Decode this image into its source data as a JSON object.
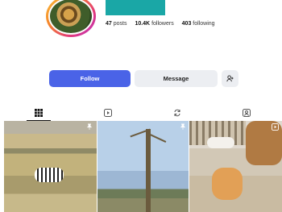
{
  "profile": {
    "posts_count": "47",
    "posts_label": "posts",
    "followers_count": "10.4K",
    "followers_label": "followers",
    "following_count": "403",
    "following_label": "following"
  },
  "actions": {
    "follow_label": "Follow",
    "message_label": "Message"
  },
  "tabs": [
    {
      "icon": "grid-icon",
      "active": true
    },
    {
      "icon": "reels-icon",
      "active": false
    },
    {
      "icon": "reposts-icon",
      "active": false
    },
    {
      "icon": "tagged-icon",
      "active": false
    }
  ],
  "posts": [
    {
      "description_icon": "pin-icon",
      "pinned": true
    },
    {
      "description_icon": "pin-icon",
      "pinned": true
    },
    {
      "description_icon": "reel-badge-icon",
      "pinned": false
    }
  ],
  "colors": {
    "accent": "#4a63e7",
    "secondary_button": "#eceef2",
    "banner": "#1aa7a6"
  }
}
